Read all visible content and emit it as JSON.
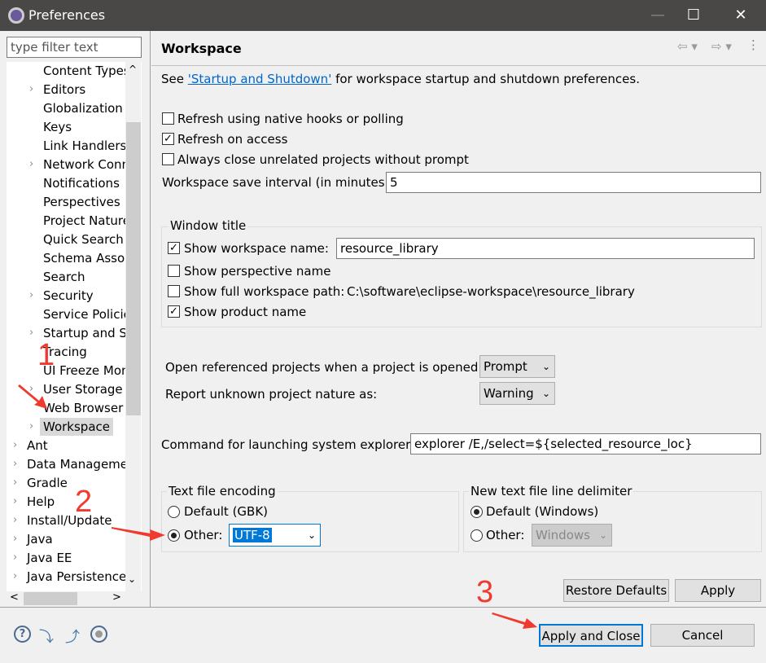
{
  "window": {
    "title": "Preferences",
    "minimize": "—",
    "maximize": "☐",
    "close": "✕"
  },
  "sidebar": {
    "filter_placeholder": "type filter text",
    "items": [
      {
        "label": "Content Types",
        "level": 2,
        "expandable": false
      },
      {
        "label": "Editors",
        "level": 2,
        "expandable": true
      },
      {
        "label": "Globalization",
        "level": 2,
        "expandable": false
      },
      {
        "label": "Keys",
        "level": 2,
        "expandable": false
      },
      {
        "label": "Link Handlers",
        "level": 2,
        "expandable": false
      },
      {
        "label": "Network Connections",
        "level": 2,
        "expandable": true
      },
      {
        "label": "Notifications",
        "level": 2,
        "expandable": false
      },
      {
        "label": "Perspectives",
        "level": 2,
        "expandable": false
      },
      {
        "label": "Project Natures",
        "level": 2,
        "expandable": false
      },
      {
        "label": "Quick Search",
        "level": 2,
        "expandable": false
      },
      {
        "label": "Schema Associations",
        "level": 2,
        "expandable": false
      },
      {
        "label": "Search",
        "level": 2,
        "expandable": false
      },
      {
        "label": "Security",
        "level": 2,
        "expandable": true
      },
      {
        "label": "Service Policies",
        "level": 2,
        "expandable": false
      },
      {
        "label": "Startup and Shutdown",
        "level": 2,
        "expandable": true
      },
      {
        "label": "Tracing",
        "level": 2,
        "expandable": false
      },
      {
        "label": "UI Freeze Monitoring",
        "level": 2,
        "expandable": false
      },
      {
        "label": "User Storage Service",
        "level": 2,
        "expandable": true
      },
      {
        "label": "Web Browser",
        "level": 2,
        "expandable": false
      },
      {
        "label": "Workspace",
        "level": 2,
        "expandable": true,
        "selected": true
      },
      {
        "label": "Ant",
        "level": 1,
        "expandable": true
      },
      {
        "label": "Data Management",
        "level": 1,
        "expandable": true
      },
      {
        "label": "Gradle",
        "level": 1,
        "expandable": true
      },
      {
        "label": "Help",
        "level": 1,
        "expandable": true
      },
      {
        "label": "Install/Update",
        "level": 1,
        "expandable": true
      },
      {
        "label": "Java",
        "level": 1,
        "expandable": true
      },
      {
        "label": "Java EE",
        "level": 1,
        "expandable": true
      },
      {
        "label": "Java Persistence",
        "level": 1,
        "expandable": true
      }
    ]
  },
  "main": {
    "title": "Workspace",
    "intro_prefix": "See ",
    "intro_link": "'Startup and Shutdown'",
    "intro_suffix": " for workspace startup and shutdown preferences.",
    "refresh_native": {
      "label": "Refresh using native hooks or polling",
      "checked": false
    },
    "refresh_access": {
      "label": "Refresh on access",
      "checked": true
    },
    "close_unrelated": {
      "label": "Always close unrelated projects without prompt",
      "checked": false
    },
    "save_interval_label": "Workspace save interval (in minutes):",
    "save_interval_value": "5",
    "window_title": {
      "legend": "Window title",
      "show_ws_name": {
        "label": "Show workspace name:",
        "checked": true,
        "value": "resource_library"
      },
      "show_perspective": {
        "label": "Show perspective name",
        "checked": false
      },
      "show_full_path": {
        "label": "Show full workspace path:",
        "checked": false,
        "value": "C:\\software\\eclipse-workspace\\resource_library"
      },
      "show_product": {
        "label": "Show product name",
        "checked": true
      }
    },
    "open_ref_label": "Open referenced projects when a project is opened:",
    "open_ref_value": "Prompt",
    "report_nature_label": "Report unknown project nature as:",
    "report_nature_value": "Warning",
    "explorer_label": "Command for launching system explorer:",
    "explorer_value": "explorer /E,/select=${selected_resource_loc}",
    "encoding": {
      "legend": "Text file encoding",
      "default_label": "Default (GBK)",
      "other_label": "Other:",
      "other_value": "UTF-8",
      "selected": "other"
    },
    "delimiter": {
      "legend": "New text file line delimiter",
      "default_label": "Default (Windows)",
      "other_label": "Other:",
      "other_value": "Windows",
      "selected": "default"
    },
    "restore_defaults": "Restore Defaults",
    "apply": "Apply"
  },
  "footer": {
    "apply_close": "Apply and Close",
    "cancel": "Cancel"
  },
  "annotations": [
    "1",
    "2",
    "3"
  ],
  "colors": {
    "titlebar": "#4a4846",
    "link": "#0066cc",
    "annotation": "#f03a2f",
    "selection": "#0078d7"
  }
}
